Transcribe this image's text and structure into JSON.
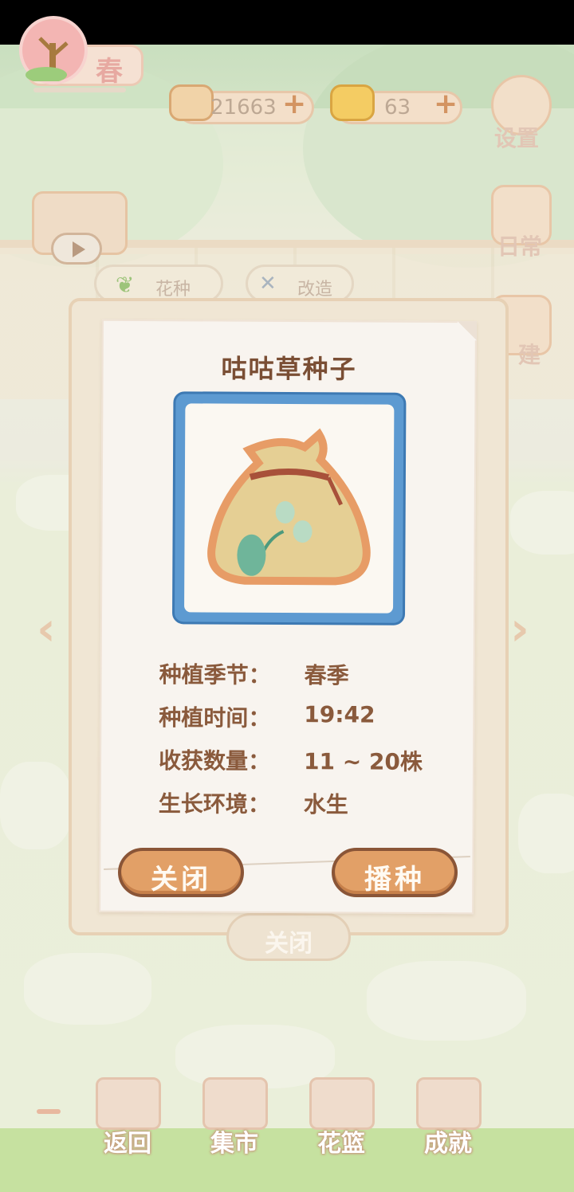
{
  "hud": {
    "season": "春",
    "fish_count": "21663",
    "cheese_count": "63",
    "settings_label": "设置",
    "daily_label": "日常",
    "build_label": "建"
  },
  "tabs": [
    {
      "label": "花种"
    },
    {
      "label": "改造"
    }
  ],
  "seed_card": {
    "title": "咕咕草种子",
    "rows": [
      {
        "label": "种植季节：",
        "value": "春季"
      },
      {
        "label": "种植时间：",
        "value": "19:42"
      },
      {
        "label": "收获数量：",
        "value": "11 ~ 20株"
      },
      {
        "label": "生长环境：",
        "value": "水生"
      }
    ],
    "close_label": "关闭",
    "sow_label": "播种"
  },
  "background_close_label": "关闭",
  "bottom_nav": [
    {
      "label": "返回"
    },
    {
      "label": "集市"
    },
    {
      "label": "花篮"
    },
    {
      "label": "成就"
    }
  ],
  "colors": {
    "title_brown": "#7a4e34",
    "button_orange": "#e2a067",
    "icon_frame_blue": "#5d9ad1"
  }
}
